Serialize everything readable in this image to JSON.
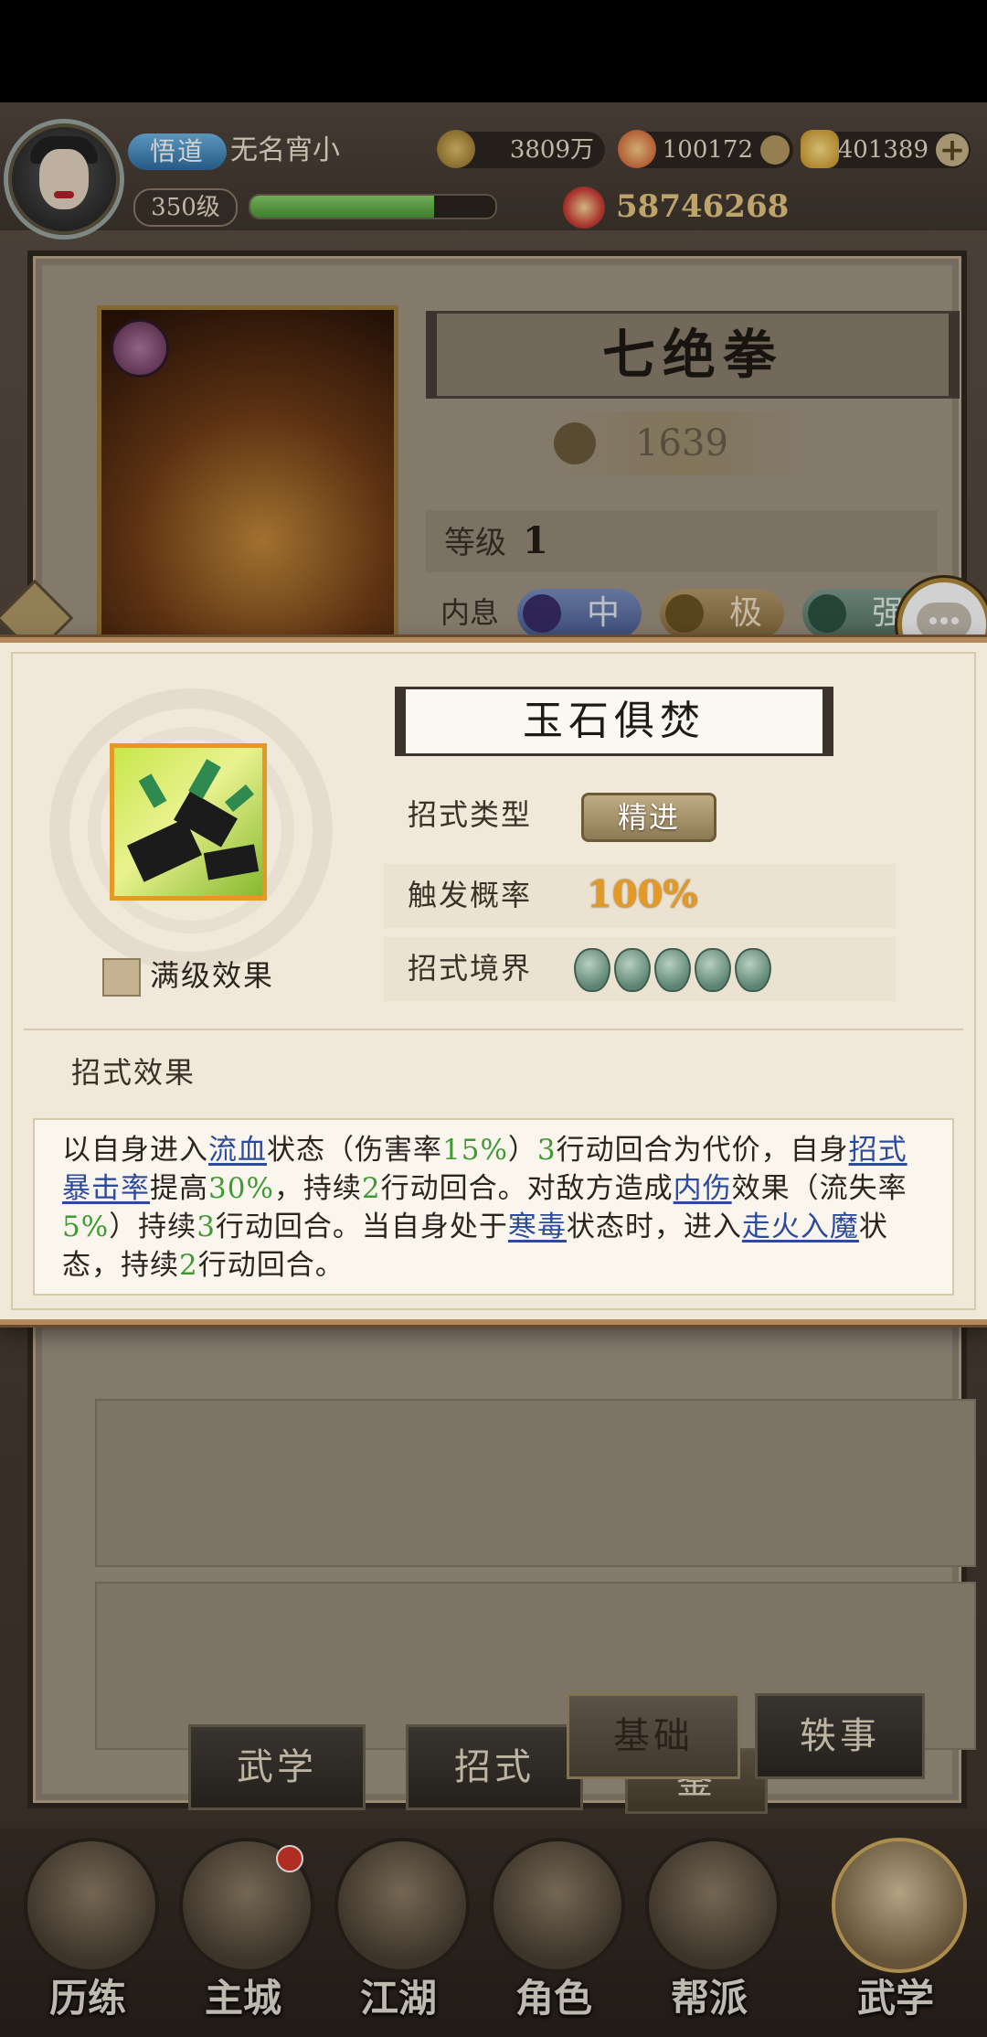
{
  "topbar": {
    "rank_badge": "悟道",
    "player_name": "无名宵小",
    "level": "350级",
    "exp_ratio": 0.75,
    "coins": "3809万",
    "gems": "100172",
    "ingots": "401389",
    "power": "58746268"
  },
  "skill_panel": {
    "title": "七绝拳",
    "power": "1639",
    "level_label": "等级",
    "level_value": "1",
    "neixi_label": "内息",
    "neixi": [
      "中",
      "极",
      "强"
    ]
  },
  "popup": {
    "title": "玉石俱焚",
    "type_label": "招式类型",
    "type_value": "精进",
    "trigger_label": "触发概率",
    "trigger_value": "100%",
    "realm_label": "招式境界",
    "realm_stars": 5,
    "max_level_label": "满级效果",
    "effect_header": "招式效果"
  },
  "effect": {
    "t1": "以自身进入",
    "k1": "流血",
    "t2": "状态（伤害率",
    "n1": "15%",
    "t3": "）",
    "n2": "3",
    "t4": "行动回合为代价，自身",
    "k2": "招式暴击率",
    "t5": "提高",
    "n3": "30%",
    "t6": "，持续",
    "n4": "2",
    "t7": "行动回合。对敌方造成",
    "k3": "内伤",
    "t8": "效果（流失率",
    "n5": "5%",
    "t9": "）持续",
    "n6": "3",
    "t10": "行动回合。当自身处于",
    "k4": "寒毒",
    "t11": "状态时，进入",
    "k5": "走火入魔",
    "t12": "状态，持续",
    "n7": "2",
    "t13": "行动回合。"
  },
  "tabs": {
    "wuxue": "武学",
    "zhaoshi": "招式",
    "jichu": "基础",
    "jian": "鉴",
    "yishi": "轶事"
  },
  "nav": {
    "lilian": "历练",
    "zhucheng": "主城",
    "jianghu": "江湖",
    "juese": "角色",
    "bangpai": "帮派",
    "wuxue": "武学"
  },
  "colors": {
    "highlight_blue": "#2c4b9c",
    "number_green": "#3f9a34",
    "accent_gold": "#e49a22"
  }
}
